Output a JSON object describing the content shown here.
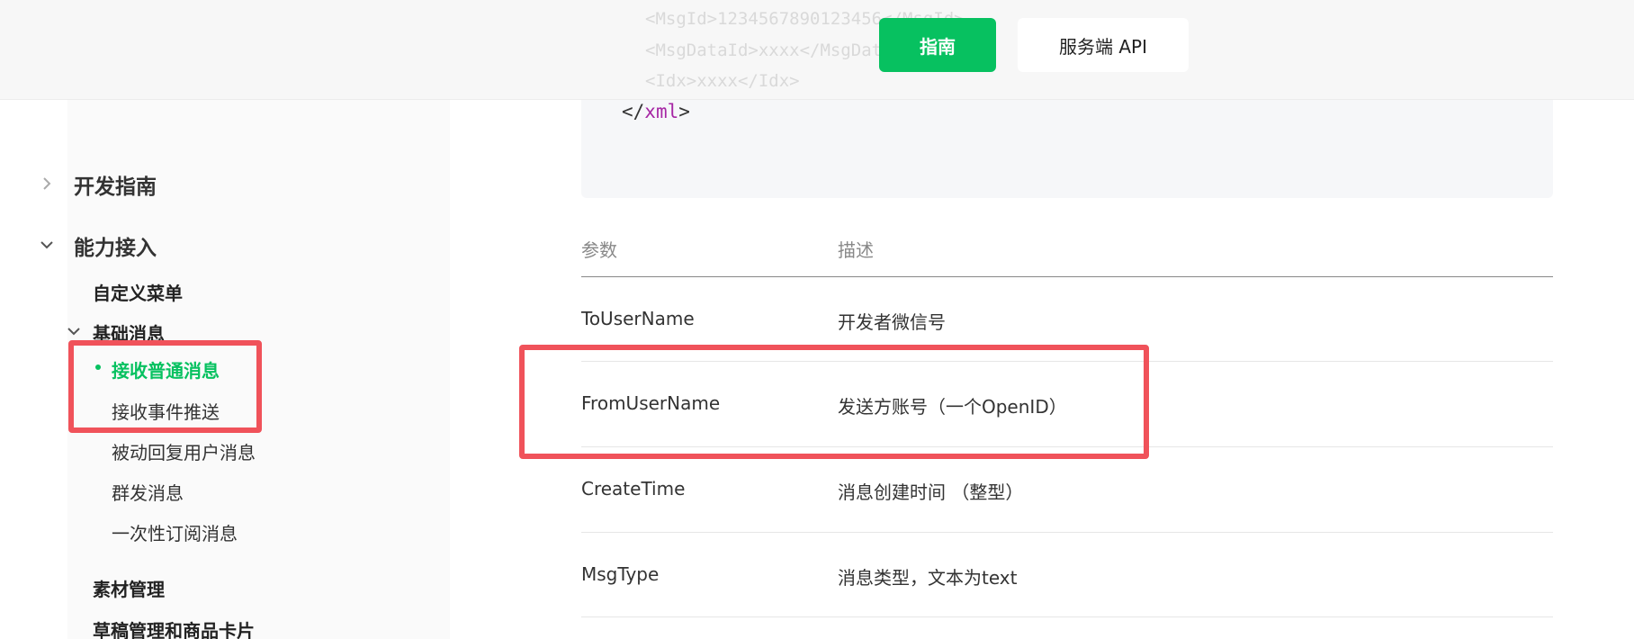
{
  "header": {
    "code_lines": [
      "<MsgId>1234567890123456</MsgId>",
      "<MsgDataId>xxxx</MsgDataId>",
      "<Idx>xxxx</Idx>"
    ],
    "guide_button": "指南",
    "api_button": "服务端 API"
  },
  "code": {
    "closing_open": "</",
    "closing_tag": "xml",
    "closing_close": ">"
  },
  "sidebar": {
    "top_items": [
      {
        "label": "开发指南",
        "expanded": false
      },
      {
        "label": "能力接入",
        "expanded": true
      }
    ],
    "level2": {
      "custom_menu": "自定义菜单",
      "basic_messages": "基础消息",
      "materials": "素材管理",
      "drafts": "草稿管理和商品卡片"
    },
    "basic_children": [
      {
        "label": "接收普通消息",
        "active": true
      },
      {
        "label": "接收事件推送",
        "active": false
      },
      {
        "label": "被动回复用户消息",
        "active": false
      },
      {
        "label": "群发消息",
        "active": false
      },
      {
        "label": "一次性订阅消息",
        "active": false
      }
    ]
  },
  "table": {
    "headers": [
      "参数",
      "描述"
    ],
    "rows": [
      [
        "ToUserName",
        "开发者微信号"
      ],
      [
        "FromUserName",
        "发送方账号（一个OpenID）"
      ],
      [
        "CreateTime",
        "消息创建时间 （整型）"
      ],
      [
        "MsgType",
        "消息类型，文本为text"
      ]
    ]
  },
  "colors": {
    "accent": "#07c160",
    "highlight": "#f0525a"
  }
}
